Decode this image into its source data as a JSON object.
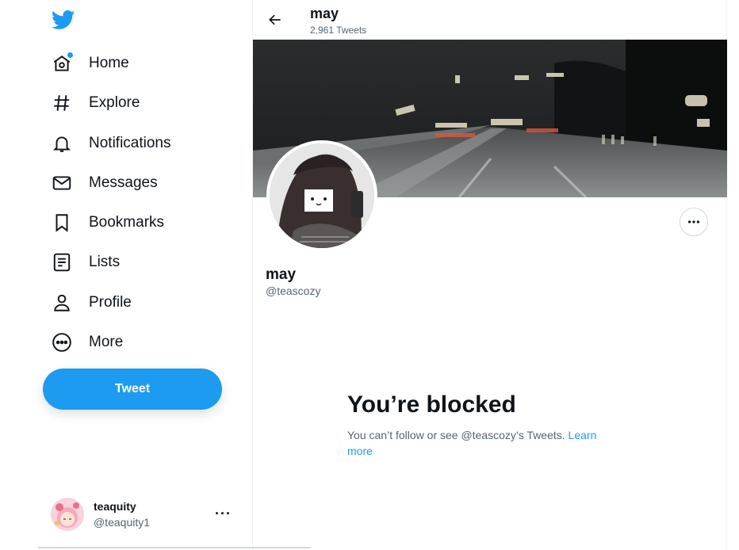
{
  "sidebar": {
    "logo": "twitter-bird-icon",
    "nav": [
      {
        "label": "Home",
        "icon": "home-icon"
      },
      {
        "label": "Explore",
        "icon": "hashtag-icon"
      },
      {
        "label": "Notifications",
        "icon": "bell-icon"
      },
      {
        "label": "Messages",
        "icon": "envelope-icon"
      },
      {
        "label": "Bookmarks",
        "icon": "bookmark-icon"
      },
      {
        "label": "Lists",
        "icon": "list-icon"
      },
      {
        "label": "Profile",
        "icon": "person-icon"
      },
      {
        "label": "More",
        "icon": "more-circle-icon"
      }
    ],
    "tweet_button": "Tweet",
    "account": {
      "name": "teaquity",
      "handle": "@teaquity1",
      "more": "···"
    }
  },
  "header": {
    "name": "may",
    "tweet_count": "2,961 Tweets"
  },
  "profile": {
    "name": "may",
    "handle": "@teascozy"
  },
  "blocked": {
    "title": "You’re blocked",
    "message": "You can’t follow or see @teascozy’s Tweets. ",
    "link": "Learn more"
  },
  "colors": {
    "accent": "#1d9bf0",
    "text": "#0f1419",
    "secondary": "#536471",
    "border": "#eff3f4"
  }
}
